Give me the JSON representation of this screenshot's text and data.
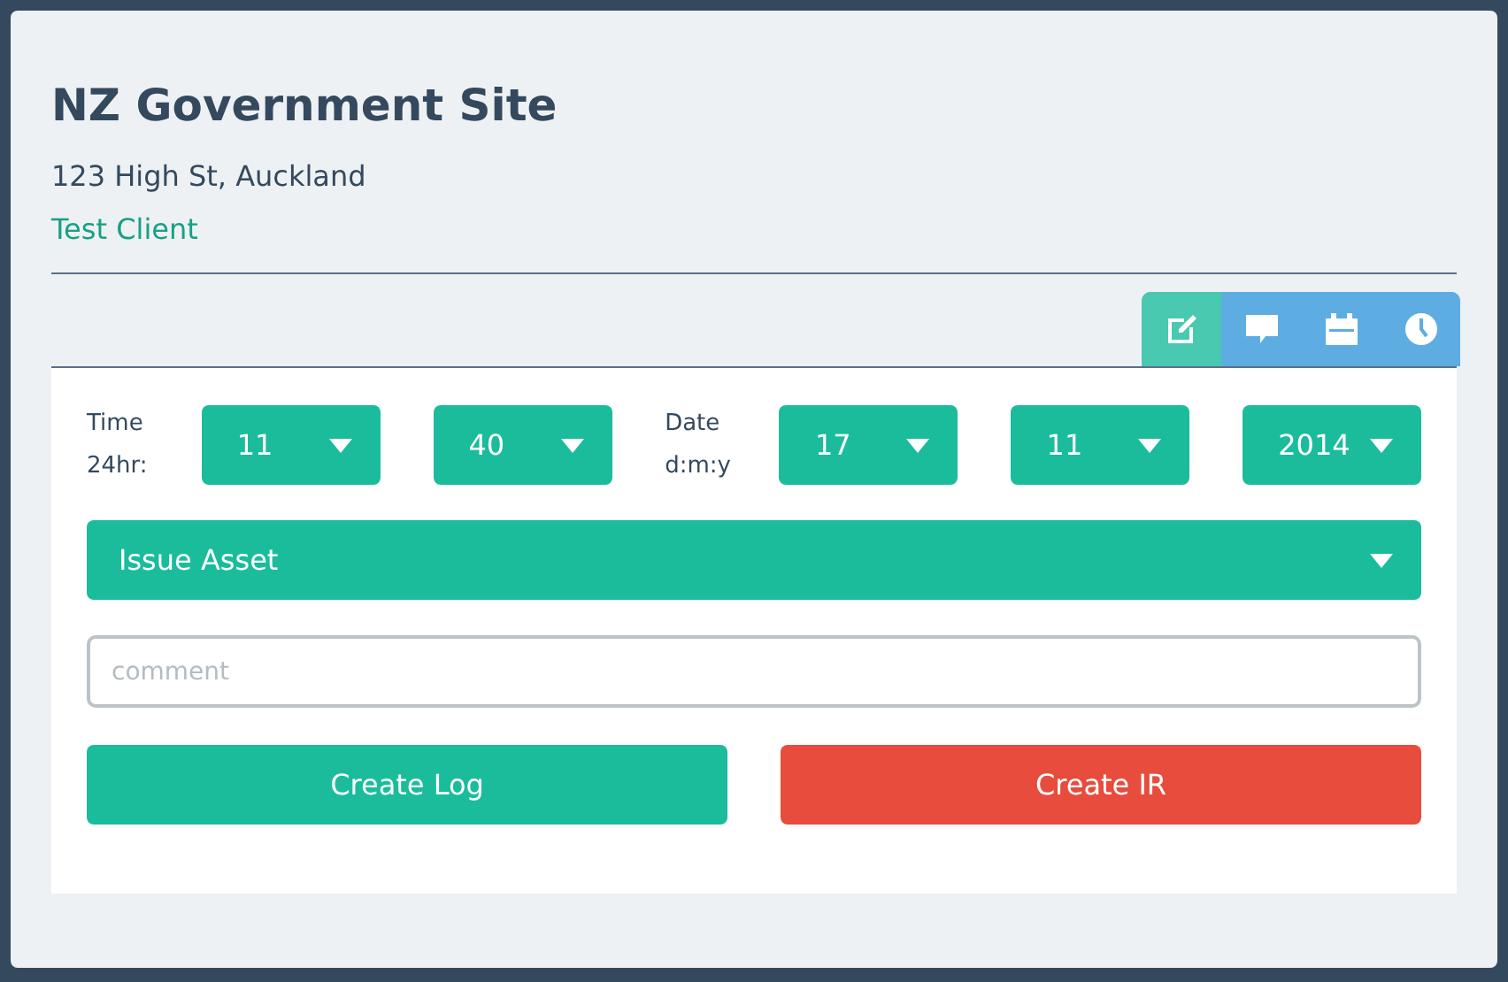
{
  "site": {
    "title": "NZ Government Site",
    "address": "123 High St, Auckland",
    "client": "Test Client"
  },
  "tabs": [
    {
      "kind": "edit",
      "selected": true
    },
    {
      "kind": "comment",
      "selected": false
    },
    {
      "kind": "calendar",
      "selected": false
    },
    {
      "kind": "clock",
      "selected": false
    }
  ],
  "form": {
    "fields": [
      {
        "kind": "label",
        "text": "Time 24hr:"
      },
      {
        "kind": "select",
        "value": "11"
      },
      {
        "kind": "select",
        "value": "40"
      },
      {
        "kind": "label",
        "text": "Date d:m:y"
      },
      {
        "kind": "select",
        "value": "17"
      },
      {
        "kind": "select",
        "value": "11"
      },
      {
        "kind": "select",
        "value": "2014"
      }
    ],
    "log_type": "Issue Asset",
    "comment": {
      "placeholder": "comment"
    },
    "buttons": [
      {
        "kind": "primary",
        "label": "Create Log"
      },
      {
        "kind": "danger",
        "label": "Create IR"
      }
    ]
  }
}
